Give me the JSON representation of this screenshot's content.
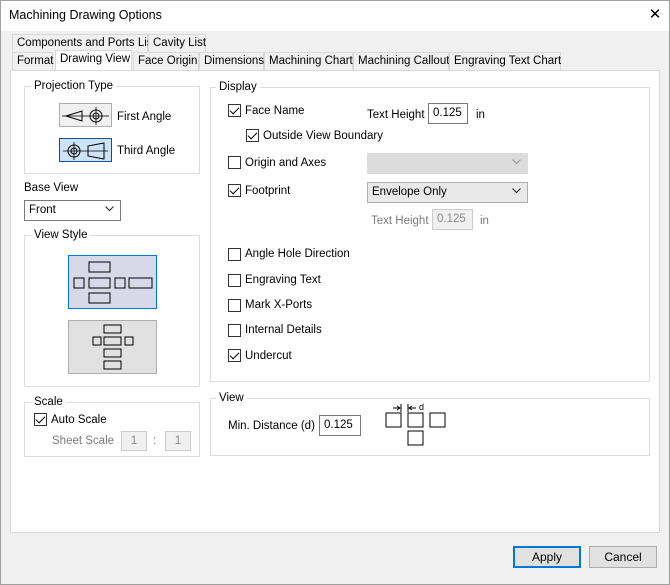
{
  "window": {
    "title": "Machining Drawing Options",
    "close_icon": "close-icon"
  },
  "tabs_row1": [
    "Components and Ports List",
    "Cavity List"
  ],
  "tabs_row2": [
    "Format",
    "Drawing View",
    "Face Origin",
    "Dimensions",
    "Machining Chart",
    "Machining Callout",
    "Engraving Text Chart"
  ],
  "active_tab": "Drawing View",
  "projection": {
    "label": "Projection Type",
    "first_angle": "First Angle",
    "third_angle": "Third Angle",
    "selected": "Third Angle"
  },
  "base_view": {
    "label": "Base View",
    "value": "Front"
  },
  "view_style": {
    "label": "View Style",
    "selected_index": 0
  },
  "scale": {
    "label": "Scale",
    "auto_scale": {
      "label": "Auto Scale",
      "checked": true
    },
    "sheet_scale_label": "Sheet Scale",
    "sheet_num": "1",
    "sheet_sep": ":",
    "sheet_den": "1"
  },
  "display": {
    "label": "Display",
    "face_name": {
      "label": "Face Name",
      "checked": true
    },
    "text_height_label": "Text Height",
    "text_height_value": "0.125",
    "unit": "in",
    "outside_view_boundary": {
      "label": "Outside View Boundary",
      "checked": true
    },
    "origin_and_axes": {
      "label": "Origin and Axes",
      "checked": false
    },
    "origin_select_value": "",
    "footprint": {
      "label": "Footprint",
      "checked": true
    },
    "footprint_select_value": "Envelope Only",
    "footprint_text_height_label": "Text Height",
    "footprint_text_height_value": "0.125",
    "footprint_unit": "in",
    "angle_hole_direction": {
      "label": "Angle Hole Direction",
      "checked": false
    },
    "engraving_text": {
      "label": "Engraving Text",
      "checked": false
    },
    "mark_x_ports": {
      "label": "Mark X-Ports",
      "checked": false
    },
    "internal_details": {
      "label": "Internal Details",
      "checked": false
    },
    "undercut": {
      "label": "Undercut",
      "checked": true
    }
  },
  "view": {
    "label": "View",
    "min_distance_label": "Min. Distance (d)",
    "min_distance_value": "0.125",
    "diagram_label": "d"
  },
  "buttons": {
    "apply": "Apply",
    "cancel": "Cancel"
  }
}
